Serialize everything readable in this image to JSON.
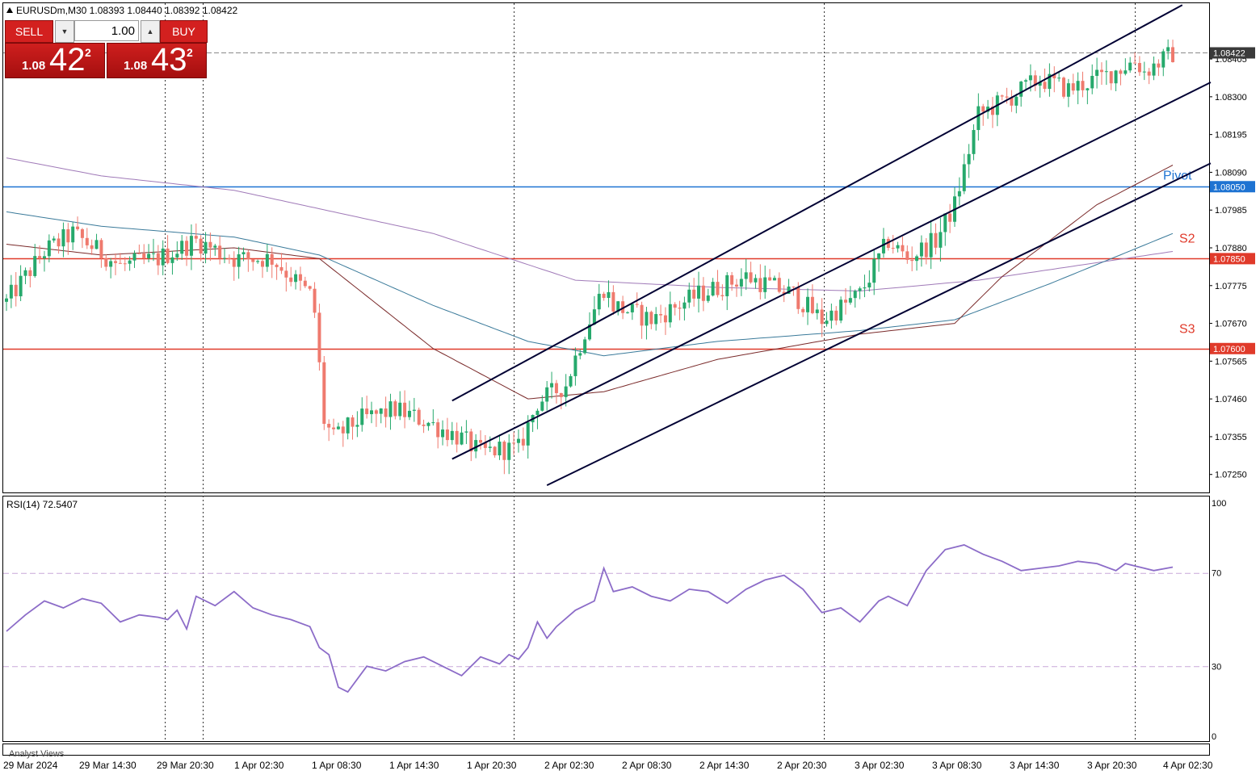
{
  "header": {
    "symbol_info": "EURUSDm,M30  1.08393 1.08440 1.08392 1.08422"
  },
  "trade_panel": {
    "sell_label": "SELL",
    "buy_label": "BUY",
    "lot": "1.00",
    "bid_small": "1.08",
    "bid_big": "42",
    "bid_sup": "2",
    "ask_small": "1.08",
    "ask_big": "43",
    "ask_sup": "2"
  },
  "rsi_label": "RSI(14) 72.5407",
  "footer_label": "Analyst Views",
  "colors": {
    "bull": "#26a96c",
    "bear": "#ef7a6e",
    "pivot": "#1e73d2",
    "support": "#e03a2a",
    "channel": "#000033",
    "rsi": "#8c6cc8",
    "ma_slow": "#a07ab8",
    "ma_mid": "#3a7a9a",
    "ma_fast": "#7a2a2a"
  },
  "chart_data": [
    {
      "type": "candlestick",
      "ylim": [
        1.072,
        1.0856
      ],
      "x_tick_labels": [
        "29 Mar 2024",
        "29 Mar 14:30",
        "29 Mar 20:30",
        "1 Apr 02:30",
        "1 Apr 08:30",
        "1 Apr 14:30",
        "1 Apr 20:30",
        "2 Apr 02:30",
        "2 Apr 08:30",
        "2 Apr 14:30",
        "2 Apr 20:30",
        "3 Apr 02:30",
        "3 Apr 08:30",
        "3 Apr 14:30",
        "3 Apr 20:30",
        "4 Apr 02:30"
      ],
      "y_tick_labels": [
        "1.08405",
        "1.08300",
        "1.08195",
        "1.08090",
        "1.07985",
        "1.07880",
        "1.07775",
        "1.07670",
        "1.07565",
        "1.07460",
        "1.07355",
        "1.07250"
      ],
      "price_tags": [
        {
          "label": "1.08422",
          "value": 1.08422,
          "kind": "current"
        },
        {
          "label": "1.08050",
          "value": 1.0805,
          "kind": "pivot"
        },
        {
          "label": "1.07850",
          "value": 1.0785,
          "kind": "support"
        },
        {
          "label": "1.07600",
          "value": 1.076,
          "kind": "support"
        }
      ],
      "levels": [
        {
          "name": "Pivot",
          "value": 1.0805,
          "kind": "pivot"
        },
        {
          "name": "S2",
          "value": 1.0785,
          "kind": "support"
        },
        {
          "name": "S3",
          "value": 1.076,
          "kind": "support"
        }
      ],
      "ohlc_anchors": [
        [
          0,
          1.0773
        ],
        [
          8,
          1.0787
        ],
        [
          14,
          1.0792
        ],
        [
          24,
          1.0783
        ],
        [
          32,
          1.0785
        ],
        [
          40,
          1.079
        ],
        [
          48,
          1.0785
        ],
        [
          56,
          1.0785
        ],
        [
          64,
          1.0775
        ],
        [
          65,
          1.077
        ],
        [
          66,
          1.0755
        ],
        [
          67,
          1.074
        ],
        [
          69,
          1.0735
        ],
        [
          74,
          1.074
        ],
        [
          82,
          1.0743
        ],
        [
          88,
          1.074
        ],
        [
          96,
          1.0735
        ],
        [
          100,
          1.0731
        ],
        [
          104,
          1.0732
        ],
        [
          108,
          1.0732
        ],
        [
          112,
          1.0745
        ],
        [
          118,
          1.075
        ],
        [
          122,
          1.0765
        ],
        [
          126,
          1.0777
        ],
        [
          128,
          1.0772
        ],
        [
          136,
          1.0768
        ],
        [
          146,
          1.0775
        ],
        [
          156,
          1.078
        ],
        [
          166,
          1.0775
        ],
        [
          172,
          1.0768
        ],
        [
          180,
          1.0775
        ],
        [
          186,
          1.079
        ],
        [
          190,
          1.0785
        ],
        [
          196,
          1.079
        ],
        [
          200,
          1.08
        ],
        [
          205,
          1.0825
        ],
        [
          212,
          1.083
        ],
        [
          218,
          1.0835
        ],
        [
          224,
          1.0832
        ],
        [
          232,
          1.0836
        ],
        [
          238,
          1.084
        ],
        [
          240,
          1.0837
        ],
        [
          246,
          1.0842
        ]
      ],
      "moving_averages": [
        {
          "kind": "ma_slow",
          "points": [
            [
              0,
              1.0813
            ],
            [
              20,
              1.0808
            ],
            [
              48,
              1.0804
            ],
            [
              90,
              1.0792
            ],
            [
              120,
              1.0779
            ],
            [
              150,
              1.0777
            ],
            [
              180,
              1.0776
            ],
            [
              205,
              1.0779
            ],
            [
              246,
              1.0787
            ]
          ]
        },
        {
          "kind": "ma_mid",
          "points": [
            [
              0,
              1.0798
            ],
            [
              20,
              1.0794
            ],
            [
              48,
              1.0791
            ],
            [
              66,
              1.0786
            ],
            [
              90,
              1.0772
            ],
            [
              110,
              1.0762
            ],
            [
              126,
              1.0758
            ],
            [
              150,
              1.0762
            ],
            [
              180,
              1.0765
            ],
            [
              200,
              1.0768
            ],
            [
              220,
              1.0778
            ],
            [
              246,
              1.0792
            ]
          ]
        },
        {
          "kind": "ma_fast",
          "points": [
            [
              0,
              1.0789
            ],
            [
              20,
              1.0786
            ],
            [
              48,
              1.0788
            ],
            [
              66,
              1.0785
            ],
            [
              90,
              1.076
            ],
            [
              110,
              1.0746
            ],
            [
              126,
              1.0748
            ],
            [
              150,
              1.0757
            ],
            [
              180,
              1.0764
            ],
            [
              200,
              1.0767
            ],
            [
              210,
              1.078
            ],
            [
              230,
              1.08
            ],
            [
              246,
              1.0811
            ]
          ]
        }
      ],
      "channel_lines": [
        {
          "from": [
            94,
            1.07455
          ],
          "to": [
            248,
            1.08555
          ]
        },
        {
          "from": [
            94,
            1.07293
          ],
          "to": [
            254,
            1.0834
          ]
        },
        {
          "from": [
            114,
            1.0722
          ],
          "to": [
            254,
            1.08115
          ]
        }
      ]
    },
    {
      "type": "line",
      "ylim": [
        0,
        100
      ],
      "y_tick_labels": [
        "100",
        "70",
        "30",
        "0"
      ],
      "levels": [
        70,
        30
      ],
      "series": [
        {
          "points": [
            [
              0,
              45
            ],
            [
              4,
              52
            ],
            [
              8,
              58
            ],
            [
              12,
              55
            ],
            [
              16,
              59
            ],
            [
              20,
              57
            ],
            [
              24,
              49
            ],
            [
              28,
              52
            ],
            [
              32,
              51
            ],
            [
              34,
              50
            ],
            [
              36,
              54
            ],
            [
              38,
              46
            ],
            [
              40,
              60
            ],
            [
              44,
              56
            ],
            [
              48,
              62
            ],
            [
              52,
              55
            ],
            [
              56,
              52
            ],
            [
              60,
              50
            ],
            [
              64,
              47
            ],
            [
              66,
              38
            ],
            [
              68,
              35
            ],
            [
              70,
              21
            ],
            [
              72,
              19
            ],
            [
              76,
              30
            ],
            [
              80,
              28
            ],
            [
              84,
              32
            ],
            [
              88,
              34
            ],
            [
              92,
              30
            ],
            [
              96,
              26
            ],
            [
              100,
              34
            ],
            [
              104,
              31
            ],
            [
              106,
              35
            ],
            [
              108,
              33
            ],
            [
              110,
              38
            ],
            [
              112,
              49
            ],
            [
              114,
              42
            ],
            [
              116,
              47
            ],
            [
              120,
              54
            ],
            [
              124,
              58
            ],
            [
              126,
              72
            ],
            [
              128,
              62
            ],
            [
              132,
              64
            ],
            [
              136,
              60
            ],
            [
              140,
              58
            ],
            [
              144,
              63
            ],
            [
              148,
              62
            ],
            [
              152,
              57
            ],
            [
              156,
              63
            ],
            [
              160,
              67
            ],
            [
              164,
              69
            ],
            [
              168,
              63
            ],
            [
              172,
              53
            ],
            [
              176,
              55
            ],
            [
              180,
              49
            ],
            [
              184,
              58
            ],
            [
              186,
              60
            ],
            [
              190,
              56
            ],
            [
              194,
              71
            ],
            [
              198,
              80
            ],
            [
              202,
              82
            ],
            [
              206,
              78
            ],
            [
              210,
              75
            ],
            [
              214,
              71
            ],
            [
              218,
              72
            ],
            [
              222,
              73
            ],
            [
              226,
              75
            ],
            [
              230,
              74
            ],
            [
              234,
              71
            ],
            [
              236,
              74
            ],
            [
              240,
              72
            ],
            [
              242,
              71
            ],
            [
              246,
              72.5
            ]
          ]
        }
      ]
    }
  ]
}
